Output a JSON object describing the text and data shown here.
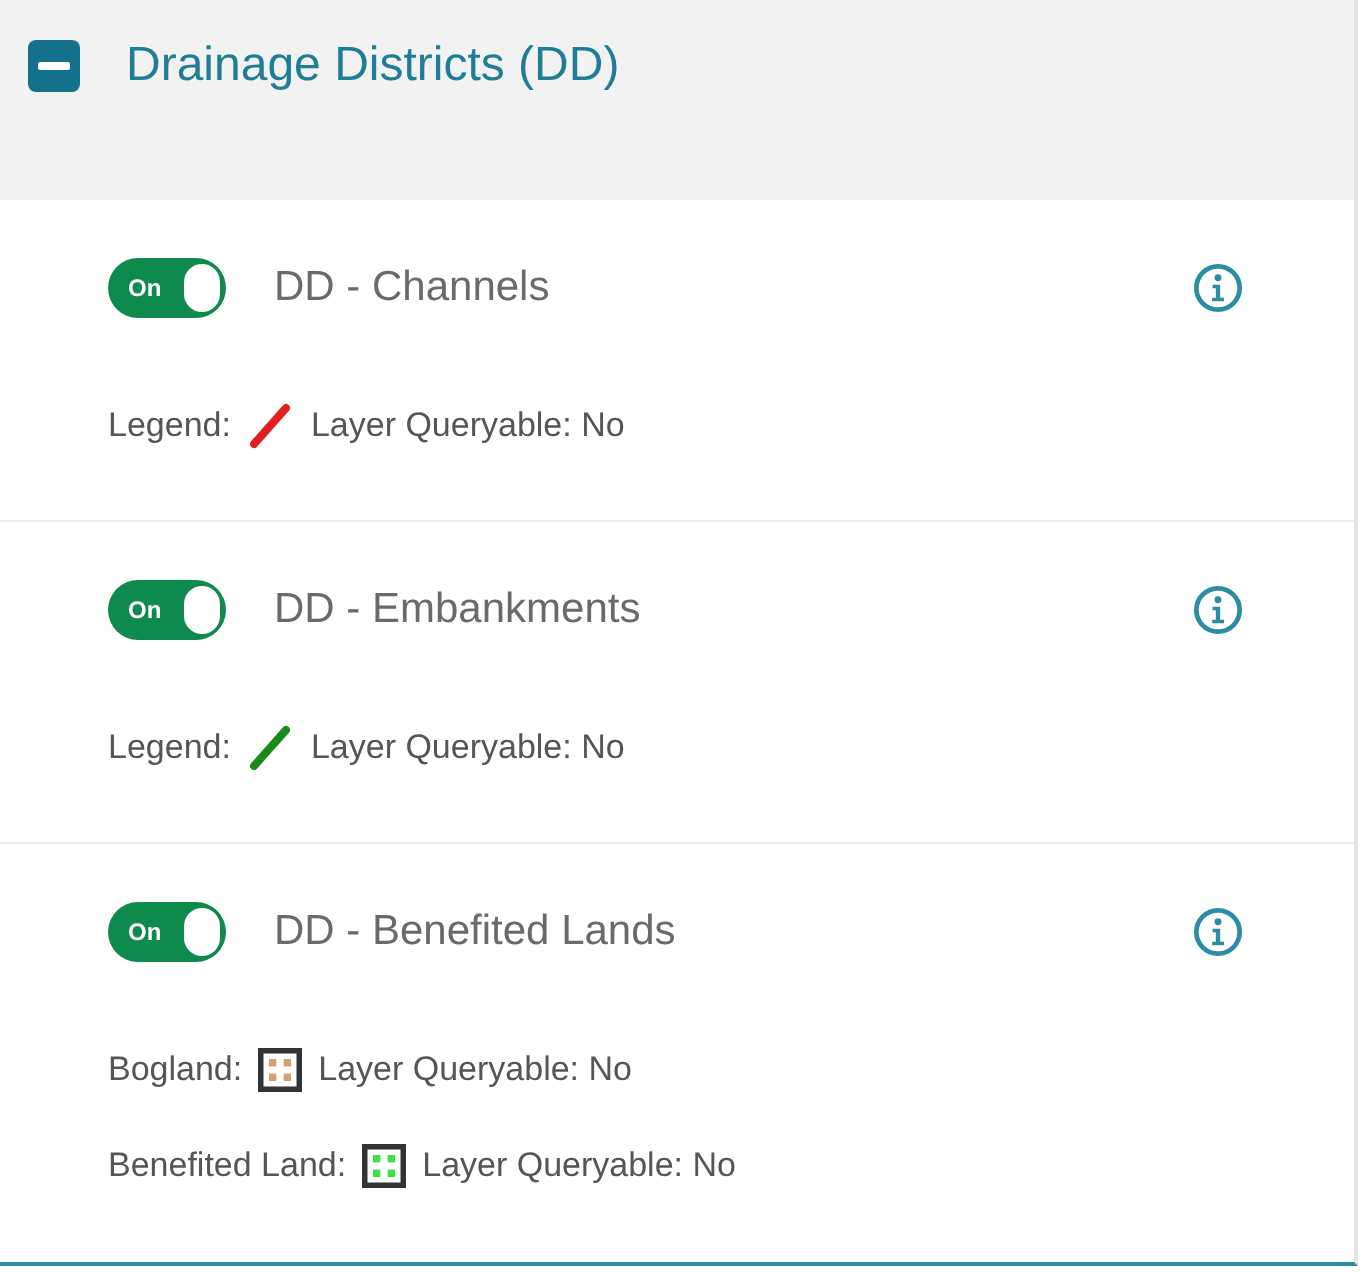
{
  "group": {
    "title": "Drainage Districts (DD)",
    "expanded": true
  },
  "layers": [
    {
      "name": "DD - Channels",
      "toggle": {
        "label": "On",
        "on": true
      },
      "legend": [
        {
          "label": "Legend:",
          "kind": "line",
          "color": "#e02020",
          "queryable": "Layer Queryable: No"
        }
      ]
    },
    {
      "name": "DD - Embankments",
      "toggle": {
        "label": "On",
        "on": true
      },
      "legend": [
        {
          "label": "Legend:",
          "kind": "line",
          "color": "#1a8a1a",
          "queryable": "Layer Queryable: No"
        }
      ]
    },
    {
      "name": "DD - Benefited Lands",
      "toggle": {
        "label": "On",
        "on": true
      },
      "legend": [
        {
          "label": "Bogland:",
          "kind": "fill",
          "color": "#d4a070",
          "queryable": "Layer Queryable: No"
        },
        {
          "label": "Benefited Land:",
          "kind": "fill",
          "color": "#40e040",
          "queryable": "Layer Queryable: No"
        }
      ]
    }
  ]
}
